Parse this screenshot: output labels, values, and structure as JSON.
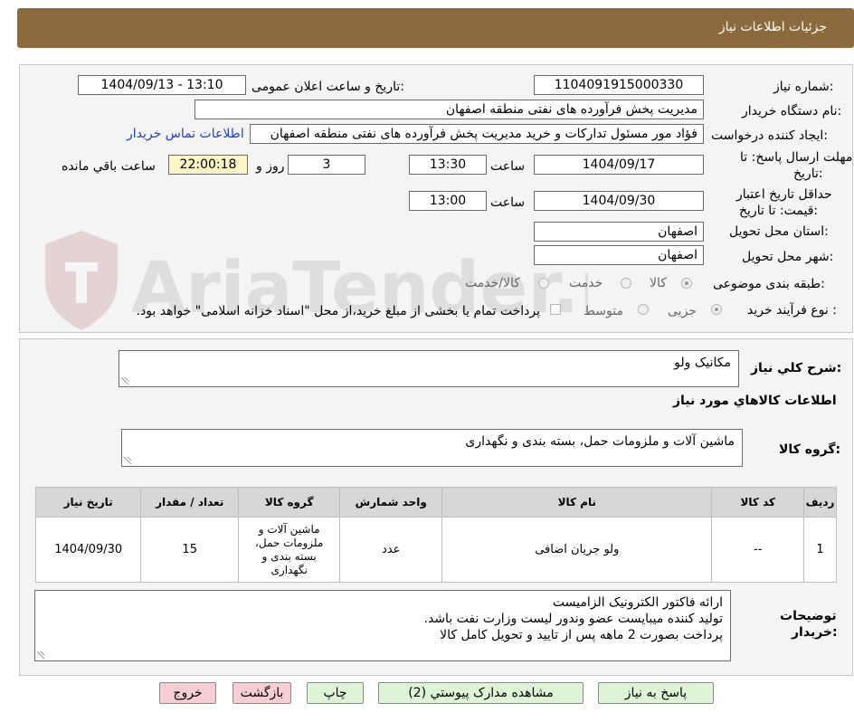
{
  "header": {
    "title": "جزئیات اطلاعات نیاز"
  },
  "fields": {
    "need_number_label": "شماره نیاز:",
    "need_number": "1104091915000330",
    "announce_label": "تاریخ و ساعت اعلان عمومی:",
    "announce_value": "1404/09/13 - 13:10",
    "buyer_org_label": "نام دستگاه خریدار:",
    "buyer_org": "مدیریت پخش فرآورده های نفتی منطقه اصفهان",
    "requester_label": "ایجاد کننده درخواست:",
    "requester": "فؤاد مور مسئول تدارکات و خرید مدیریت پخش فرآورده های نفتی منطقه اصفهان",
    "contact_link": "اطلاعات تماس خریدار",
    "deadline_label_1": "مهلت ارسال پاسخ: تا",
    "deadline_label_2": "تاریخ:",
    "deadline_date": "1404/09/17",
    "time_word": "ساعت",
    "deadline_time": "13:30",
    "days_value": "3",
    "days_word": "روز و",
    "remaining_time": "22:00:18",
    "remaining_word": "ساعت باقي مانده",
    "validity_label_1": "حداقل تاریخ اعتبار",
    "validity_label_2": "قیمت: تا تاریخ:",
    "validity_date": "1404/09/30",
    "validity_time": "13:00",
    "province_label": "استان محل تحویل:",
    "province": "اصفهان",
    "city_label": "شهر محل تحویل:",
    "city": "اصفهان",
    "category_label": "طبقه بندی موضوعی:",
    "category_options": [
      "کالا",
      "خدمت",
      "کالا/خدمت"
    ],
    "process_label": "نوع فرآیند خرید :",
    "process_options": [
      "جزیی",
      "متوسط"
    ],
    "payment_note": "پرداخت تمام یا بخشی از مبلغ خرید،از محل \"اسناد خزانه اسلامی\" خواهد بود."
  },
  "general": {
    "summary_label": "شرح کلي نیاز:",
    "summary": "مکانیک ولو",
    "items_info_title": "اطلاعات کالاهاي مورد نیاز",
    "group_label": "گروه کالا:",
    "group": "ماشین آلات و ملزومات حمل، بسته بندی و نگهداری"
  },
  "table": {
    "headers": [
      "ردیف",
      "کد کالا",
      "نام کالا",
      "واحد شمارش",
      "گروه کالا",
      "تعداد / مقدار",
      "تاریخ نیاز"
    ],
    "rows": [
      [
        "1",
        "--",
        "ولو جریان اضافی",
        "عدد",
        "ماشین آلات و ملزومات حمل، بسته بندی و نگهداری",
        "15",
        "1404/09/30"
      ]
    ]
  },
  "notes": {
    "label_1": "توضیحات",
    "label_2": "خریدار:",
    "lines": [
      "ارائه فاکتور الکترونیک الزامیست",
      "تولید کننده میبایست عضو وندور لیست وزارت نفت باشد.",
      "پرداخت بصورت 2 ماهه پس از تایید و تحویل کامل کالا"
    ]
  },
  "buttons": {
    "reply": "پاسخ به نیاز",
    "attachments": "مشاهده مدارک پیوستي (2)",
    "print": "چاپ",
    "back": "بازگشت",
    "exit": "خروج"
  },
  "watermark": {
    "text": "AriaTender.neT"
  },
  "colors": {
    "header": "#8b6b3e",
    "link": "#1f3fbf",
    "green_button": "#dff3d7",
    "pink_button": "#f7cfd3"
  }
}
